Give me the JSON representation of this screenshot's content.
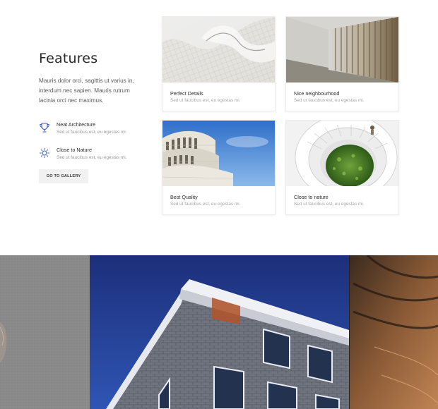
{
  "features": {
    "title": "Features",
    "description": "Mauris dolor orci, sagittis ut varius in, interdum nec sapien. Mauris rutrum lacinia orci nec maximus.",
    "items": [
      {
        "icon": "trophy-icon",
        "title": "Neat Architecture",
        "subtitle": "Sed ut faucibus est, eu egestas mi."
      },
      {
        "icon": "sun-icon",
        "title": "Close to Nature",
        "subtitle": "Sed ut faucibus est, eu egestas mi."
      }
    ],
    "button_label": "GO TO GALLERY"
  },
  "cards": [
    {
      "title": "Perfect Details",
      "subtitle": "Sed ut faucibus est, eu egestas mi."
    },
    {
      "title": "Nice neighbourhood",
      "subtitle": "Sed ut faucibus est, eu egestas mi."
    },
    {
      "title": "Best Quality",
      "subtitle": "Sed ut faucibus est, eu egestas mi."
    },
    {
      "title": "Close to nature",
      "subtitle": "Sed ut faucibus est, eu egestas mi."
    }
  ],
  "colors": {
    "accent": "#3a5bbf",
    "sky": "#1e3f9a",
    "card_border": "#ececec"
  }
}
